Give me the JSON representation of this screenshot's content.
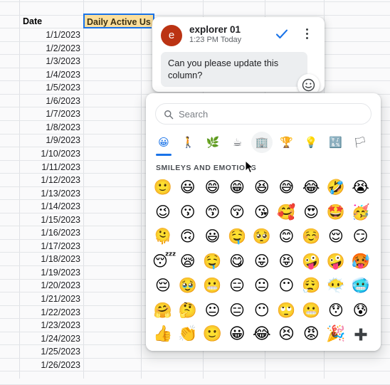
{
  "sheet": {
    "header_row": {
      "date_label": "Date",
      "metric_label": "Daily Active Us"
    },
    "dates": [
      "1/1/2023",
      "1/2/2023",
      "1/3/2023",
      "1/4/2023",
      "1/5/2023",
      "1/6/2023",
      "1/7/2023",
      "1/8/2023",
      "1/9/2023",
      "1/10/2023",
      "1/11/2023",
      "1/12/2023",
      "1/13/2023",
      "1/14/2023",
      "1/15/2023",
      "1/16/2023",
      "1/17/2023",
      "1/18/2023",
      "1/19/2023",
      "1/20/2023",
      "1/21/2023",
      "1/22/2023",
      "1/23/2023",
      "1/24/2023",
      "1/25/2023",
      "1/26/2023"
    ],
    "selection_fill": "#fbdf9c",
    "selection_border": "#1a73e8"
  },
  "comment": {
    "avatar_initial": "e",
    "avatar_color": "#bb3313",
    "author": "explorer 01",
    "timestamp": "1:23 PM Today",
    "body": "Can you please update this column?",
    "resolve_icon": "checkmark-icon",
    "resolve_color": "#1a73e8",
    "menu_icon": "overflow-menu-icon",
    "react_icon": "emoji-smile-icon"
  },
  "picker": {
    "search": {
      "placeholder": "Search",
      "icon": "search-icon"
    },
    "tabs": [
      {
        "name": "smileys",
        "glyph": "😀",
        "active": true
      },
      {
        "name": "people",
        "glyph": "🚶",
        "active": false
      },
      {
        "name": "animals-nature",
        "glyph": "🌿",
        "active": false
      },
      {
        "name": "food-drink",
        "glyph": "☕",
        "active": false
      },
      {
        "name": "travel-places",
        "glyph": "🏢",
        "active": false
      },
      {
        "name": "activities",
        "glyph": "🏆",
        "active": false
      },
      {
        "name": "objects",
        "glyph": "💡",
        "active": false
      },
      {
        "name": "symbols",
        "glyph": "🔣",
        "active": false
      },
      {
        "name": "flags",
        "glyph": "🏳",
        "active": false
      }
    ],
    "section_title": "SMILEYS AND EMOTIONS",
    "active_tab_index": 0,
    "hover_tab_index": 4,
    "accent_color": "#1a73e8",
    "rows": [
      [
        "🙂",
        "😃",
        "😄",
        "😁",
        "😆",
        "😅",
        "😂",
        "🤣",
        "😭"
      ],
      [
        "😉",
        "😗",
        "😙",
        "😚",
        "😘",
        "🥰",
        "😍",
        "🤩",
        "🥳"
      ],
      [
        "🫠",
        "🙃",
        "😃",
        "🤤",
        "🥺",
        "😊",
        "☺️",
        "😌",
        "😏"
      ],
      [
        "😴",
        "😪",
        "🤤",
        "😋",
        "😛",
        "😝",
        "🤪",
        "🤪",
        "🥵"
      ],
      [
        "😔",
        "🥹",
        "😬",
        "😑",
        "😐",
        "😶",
        "😮‍💨",
        "😶‍🌫️",
        "🥶"
      ],
      [
        "🤗",
        "🤔",
        "😐",
        "😑",
        "😶",
        "🙄",
        "😬",
        "😯",
        "😰"
      ]
    ],
    "quick_reactions": [
      "👍",
      "👏",
      "🙂",
      "😀",
      "😂",
      "😣",
      "😡",
      "🎉"
    ],
    "plus_icon": "plus-icon"
  },
  "cursor": {
    "icon": "mouse-pointer-icon"
  }
}
